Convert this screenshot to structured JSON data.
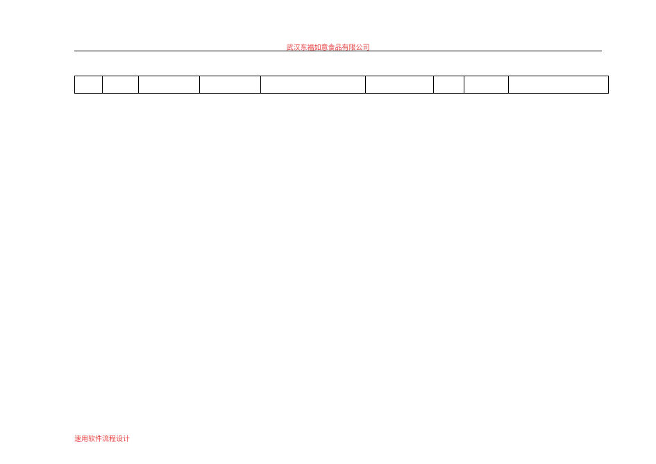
{
  "header": {
    "company_name": "武汉东福如意食品有限公司"
  },
  "table": {
    "rows": [
      {
        "c1": "",
        "c2": "",
        "c3": "",
        "c4": "",
        "c5": "",
        "c6": "",
        "c7": "",
        "c8": "",
        "c9": ""
      }
    ]
  },
  "footer": {
    "design_credit": "速用软件流程设计"
  }
}
